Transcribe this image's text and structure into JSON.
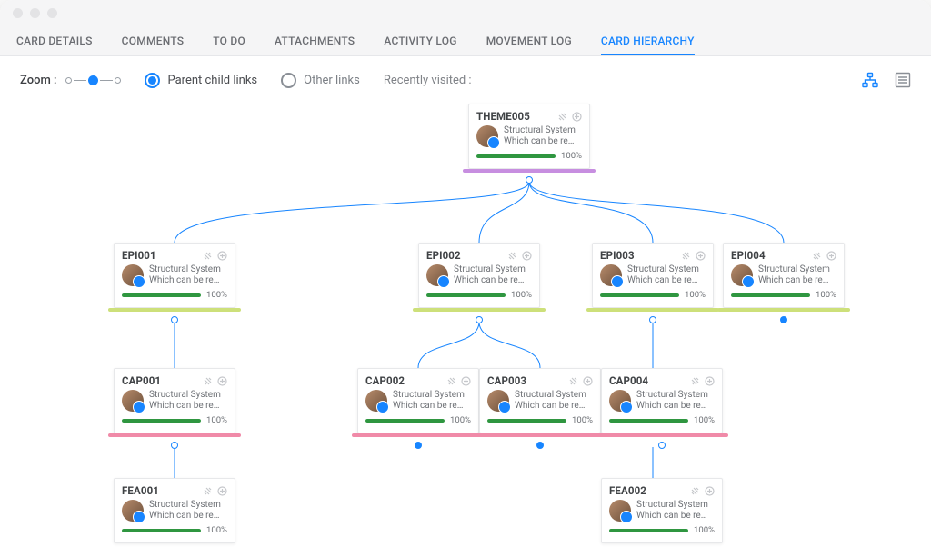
{
  "tabs": {
    "card_details": "CARD DETAILS",
    "comments": "COMMENTS",
    "to_do": "TO DO",
    "attachments": "ATTACHMENTS",
    "activity_log": "ACTIVITY LOG",
    "movement_log": "MOVEMENT LOG",
    "card_hierarchy": "CARD HIERARCHY"
  },
  "toolbar": {
    "zoom_label": "Zoom :",
    "parent_child_links": "Parent child links",
    "other_links": "Other  links",
    "recently_visited": "Recently visited :"
  },
  "cards": {
    "theme005": {
      "id": "THEME005",
      "title": "Structural System",
      "subtitle": "Which can be re…",
      "progress": "100%"
    },
    "epi001": {
      "id": "EPI001",
      "title": "Structural System",
      "subtitle": "Which can be re…",
      "progress": "100%"
    },
    "epi002": {
      "id": "EPI002",
      "title": "Structural System",
      "subtitle": "Which can be re…",
      "progress": "100%"
    },
    "epi003": {
      "id": "EPI003",
      "title": "Structural System",
      "subtitle": "Which can be re…",
      "progress": "100%"
    },
    "epi004": {
      "id": "EPI004",
      "title": "Structural System",
      "subtitle": "Which can be re…",
      "progress": "100%"
    },
    "cap001": {
      "id": "CAP001",
      "title": "Structural System",
      "subtitle": "Which can be re…",
      "progress": "100%"
    },
    "cap002": {
      "id": "CAP002",
      "title": "Structural System",
      "subtitle": "Which can be re…",
      "progress": "100%"
    },
    "cap003": {
      "id": "CAP003",
      "title": "Structural System",
      "subtitle": "Which can be re…",
      "progress": "100%"
    },
    "cap004": {
      "id": "CAP004",
      "title": "Structural System",
      "subtitle": "Which can be re…",
      "progress": "100%"
    },
    "fea001": {
      "id": "FEA001",
      "title": "Structural System",
      "subtitle": "Which can be re…",
      "progress": "100%"
    },
    "fea002": {
      "id": "FEA002",
      "title": "Structural System",
      "subtitle": "Which can be re…",
      "progress": "100%"
    }
  },
  "colors": {
    "link_blue": "#1785ff",
    "progress_green": "#2f9640",
    "accent_purple": "#c78ee0",
    "accent_lime": "#cde07a",
    "accent_pink": "#f08aa8"
  }
}
